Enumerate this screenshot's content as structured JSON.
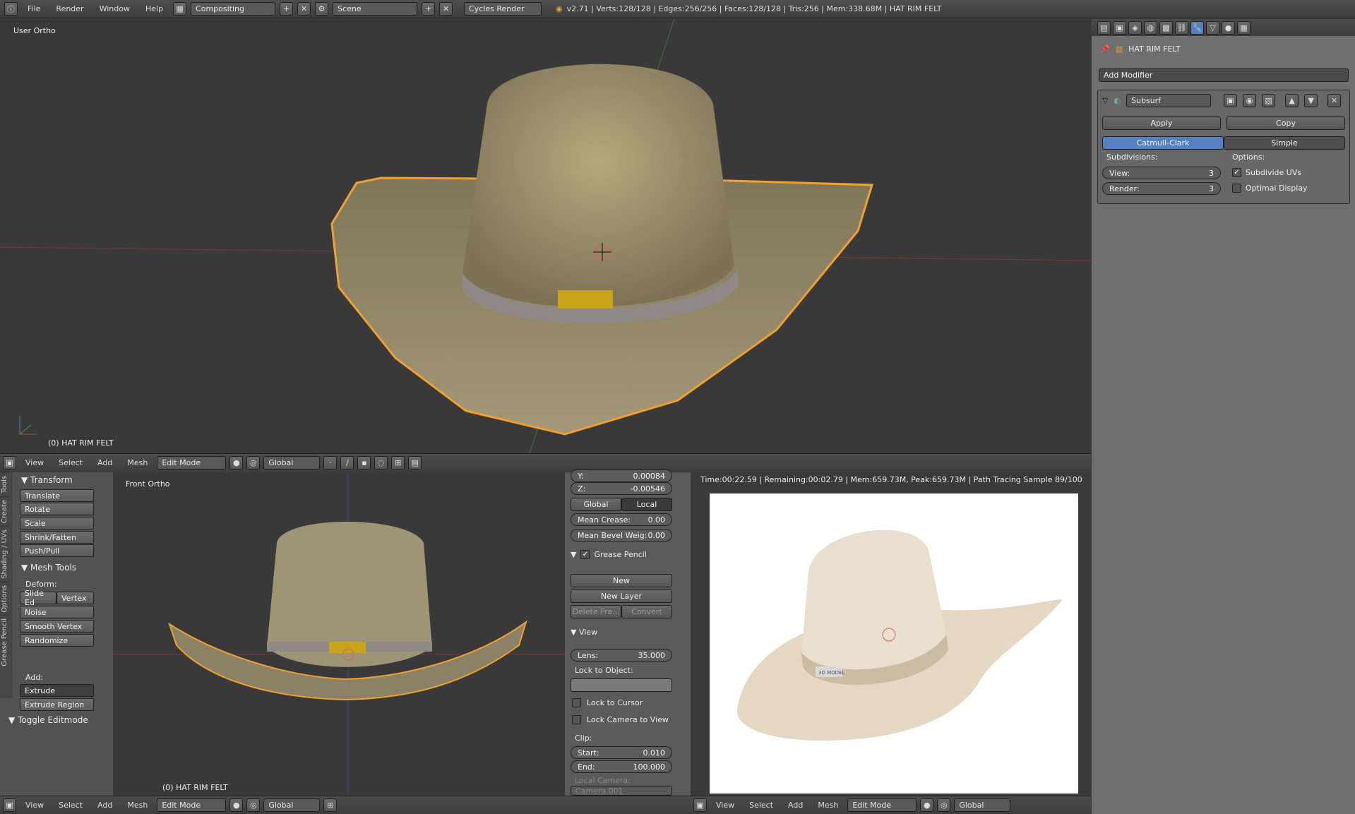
{
  "topbar": {
    "menus": [
      "File",
      "Render",
      "Window",
      "Help"
    ],
    "screen": "Compositing",
    "scene": "Scene",
    "engine": "Cycles Render",
    "stats": "v2.71 | Verts:128/128 | Edges:256/256 | Faces:128/128 | Tris:256 | Mem:338.68M | HAT RIM FELT"
  },
  "viewport_top": {
    "view_label": "User Ortho",
    "object_label": "(0) HAT RIM FELT"
  },
  "header_top": {
    "menus": [
      "View",
      "Select",
      "Add",
      "Mesh"
    ],
    "mode": "Edit Mode",
    "orientation": "Global"
  },
  "properties": {
    "object": "HAT RIM FELT",
    "add_modifier": "Add Modifier",
    "modifier_name": "Subsurf",
    "apply": "Apply",
    "copy": "Copy",
    "catmull": "Catmull-Clark",
    "simple": "Simple",
    "subdivisions": "Subdivisions:",
    "options": "Options:",
    "view_label": "View:",
    "view_value": "3",
    "render_label": "Render:",
    "render_value": "3",
    "subdivide_uvs": "Subdivide UVs",
    "optimal_display": "Optimal Display"
  },
  "tools": {
    "tabs": [
      "Tools",
      "Create",
      "Shading / UVs",
      "Options",
      "Grease Pencil"
    ],
    "transform": "Transform",
    "transform_items": [
      "Translate",
      "Rotate",
      "Scale",
      "Shrink/Fatten",
      "Push/Pull"
    ],
    "mesh_tools": "Mesh Tools",
    "deform": "Deform:",
    "slide_edge": "Slide Ed",
    "vertex": "Vertex",
    "deform_items": [
      "Noise",
      "Smooth Vertex",
      "Randomize"
    ],
    "add": "Add:",
    "extrude": "Extrude",
    "extrude_region": "Extrude Region",
    "toggle_editmode": "Toggle Editmode"
  },
  "viewport_front": {
    "view_label": "Front Ortho",
    "object_label": "(0) HAT RIM FELT"
  },
  "npanel": {
    "y_label": "Y:",
    "y_value": "0.00084",
    "z_label": "Z:",
    "z_value": "-0.00546",
    "global": "Global",
    "local": "Local",
    "mean_crease": "Mean Crease:",
    "mean_crease_value": "0.00",
    "mean_bevel": "Mean Bevel Weig:",
    "mean_bevel_value": "0.00",
    "grease_pencil": "Grease Pencil",
    "new": "New",
    "new_layer": "New Layer",
    "delete_frame": "Delete Fra...",
    "convert": "Convert",
    "view": "View",
    "lens_label": "Lens:",
    "lens_value": "35.000",
    "lock_to_object": "Lock to Object:",
    "lock_to_cursor": "Lock to Cursor",
    "lock_camera": "Lock Camera to View",
    "clip": "Clip:",
    "start_label": "Start:",
    "start_value": "0.010",
    "end_label": "End:",
    "end_value": "100.000",
    "local_camera": "Local Camera:",
    "camera_value": "Camera.001"
  },
  "render": {
    "status": "Time:00:22.59 | Remaining:00:02.79 | Mem:659.73M, Peak:659.73M | Path Tracing Sample 89/100",
    "badge": "3D MODEL"
  },
  "header_bottom_left": {
    "menus": [
      "View",
      "Select",
      "Add",
      "Mesh"
    ],
    "mode": "Edit Mode",
    "orientation": "Global"
  },
  "header_bottom_right": {
    "menus": [
      "View",
      "Select",
      "Add",
      "Mesh"
    ],
    "mode": "Edit Mode",
    "orientation": "Global"
  },
  "colors": {
    "accent": "#5680c2",
    "selection": "#f5a623",
    "bg": "#393939"
  }
}
